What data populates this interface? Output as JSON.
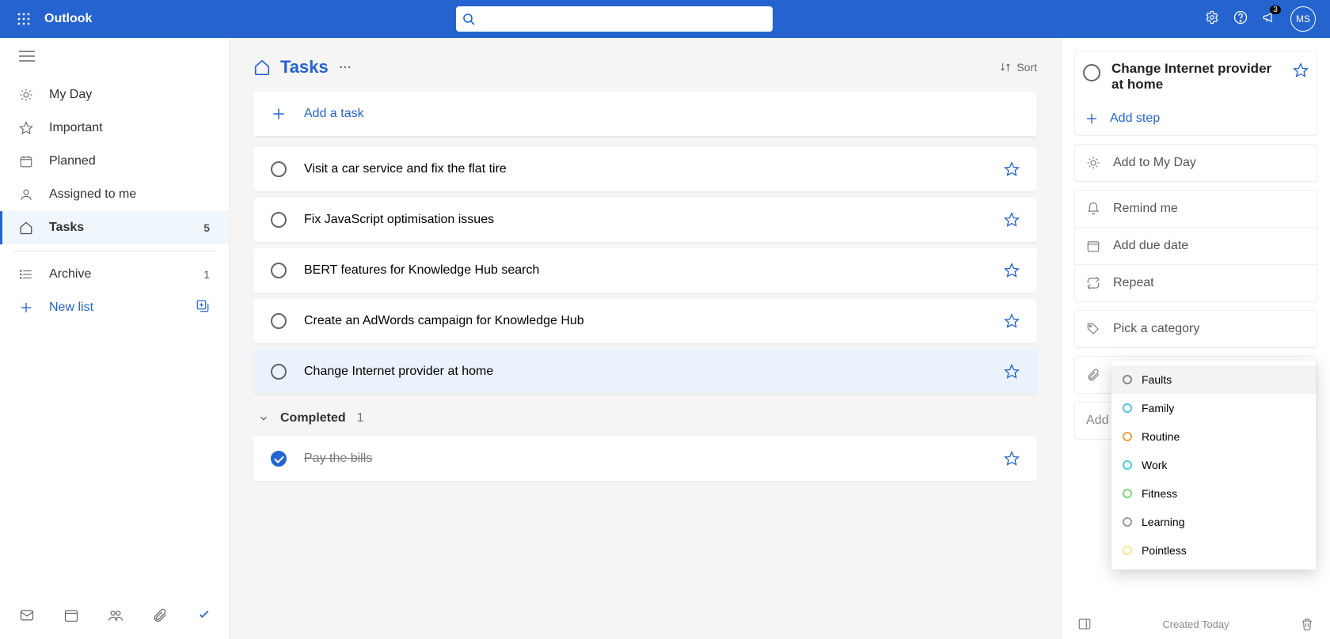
{
  "header": {
    "app_name": "Outlook",
    "search_placeholder": "",
    "notif_count": "3",
    "avatar_initials": "MS"
  },
  "sidebar": {
    "items": [
      {
        "label": "My Day"
      },
      {
        "label": "Important"
      },
      {
        "label": "Planned"
      },
      {
        "label": "Assigned to me"
      },
      {
        "label": "Tasks",
        "count": "5"
      }
    ],
    "custom": [
      {
        "label": "Archive",
        "count": "1"
      }
    ],
    "new_list_label": "New list"
  },
  "main": {
    "title": "Tasks",
    "sort_label": "Sort",
    "add_task_label": "Add a task",
    "tasks": [
      {
        "title": "Visit a car service and fix the flat tire"
      },
      {
        "title": "Fix JavaScript optimisation issues"
      },
      {
        "title": "BERT features for Knowledge Hub search"
      },
      {
        "title": "Create an AdWords campaign for Knowledge Hub"
      },
      {
        "title": "Change Internet provider at home",
        "selected": true
      }
    ],
    "completed_label": "Completed",
    "completed_count": "1",
    "completed": [
      {
        "title": "Pay the bills"
      }
    ]
  },
  "detail": {
    "title": "Change Internet provider at home",
    "add_step": "Add step",
    "rows": {
      "myday": "Add to My Day",
      "remind": "Remind me",
      "due": "Add due date",
      "repeat": "Repeat",
      "category": "Pick a category",
      "file": "Add file",
      "note": "Add note"
    },
    "created": "Created Today"
  },
  "categories": [
    {
      "name": "Faults",
      "color": "#888888"
    },
    {
      "name": "Family",
      "color": "#4ec5e0"
    },
    {
      "name": "Routine",
      "color": "#e8a33d"
    },
    {
      "name": "Work",
      "color": "#49d0d0"
    },
    {
      "name": "Fitness",
      "color": "#7cd47c"
    },
    {
      "name": "Learning",
      "color": "#9a9a9a"
    },
    {
      "name": "Pointless",
      "color": "#f3ea8a"
    }
  ]
}
